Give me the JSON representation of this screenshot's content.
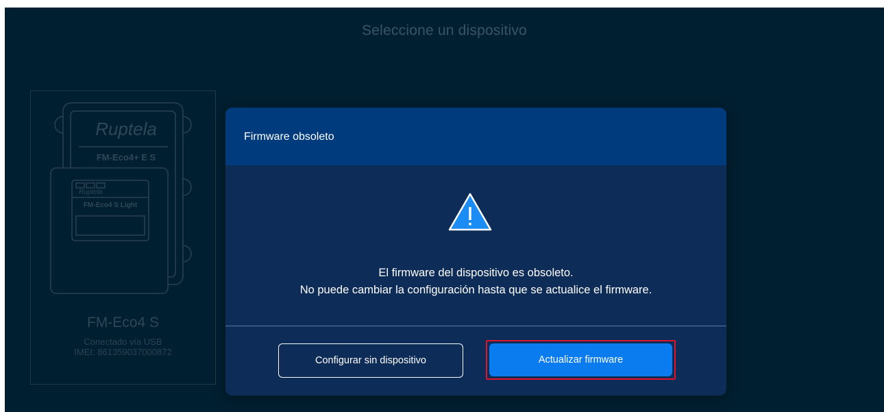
{
  "page": {
    "title": "Seleccione un dispositivo"
  },
  "device": {
    "name": "FM-Eco4 S",
    "connection": "Conectado vía USB",
    "imei": "IMEI: 861359037000872",
    "art_brand": "Ruptela",
    "art_model_back": "FM-Eco4+ E S",
    "art_model_front": "FM-Eco4 S Light"
  },
  "modal": {
    "title": "Firmware obsoleto",
    "message_line1": "El firmware del dispositivo es obsoleto.",
    "message_line2": "No puede cambiar la configuración hasta que se actualice el firmware.",
    "secondary_button": "Configurar sin dispositivo",
    "primary_button": "Actualizar firmware",
    "icon": "warning-triangle-icon"
  },
  "colors": {
    "background": "#001f30",
    "modal_body": "#0e2c58",
    "modal_header": "#003b7e",
    "primary_button": "#0b7cf0",
    "highlight_outline": "#e0142c",
    "warning_icon": "#1a8cf4"
  }
}
